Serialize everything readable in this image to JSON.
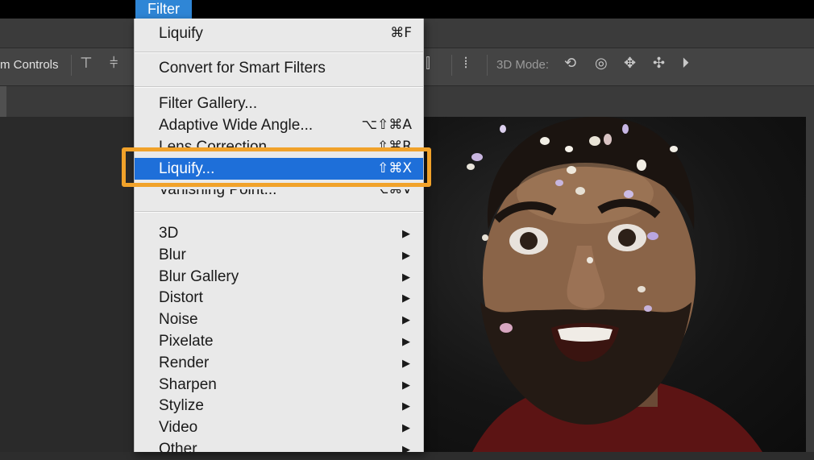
{
  "menubar": {
    "active_menu": "Filter"
  },
  "options_bar": {
    "transform_controls_label": "m Controls",
    "mode_3d_label": "3D Mode:"
  },
  "filter_menu": {
    "top_item": {
      "label": "Liquify",
      "shortcut": "⌘F"
    },
    "smart_filters": {
      "label": "Convert for Smart Filters"
    },
    "gallery_group": [
      {
        "label": "Filter Gallery...",
        "shortcut": ""
      },
      {
        "label": "Adaptive Wide Angle...",
        "shortcut": "⌥⇧⌘A"
      },
      {
        "label": "Lens Correction...",
        "shortcut": "⇧⌘R"
      },
      {
        "label": "Liquify...",
        "shortcut": "⇧⌘X"
      },
      {
        "label": "Vanishing Point...",
        "shortcut": "⌥⌘V"
      }
    ],
    "submenus": [
      "3D",
      "Blur",
      "Blur Gallery",
      "Distort",
      "Noise",
      "Pixelate",
      "Render",
      "Sharpen",
      "Stylize",
      "Video",
      "Other"
    ],
    "submenu_arrow": "▶",
    "highlighted_item": "Liquify...",
    "highlight_color": "#1e6fd9",
    "annotation_color": "#f1a22a"
  },
  "icons": [
    "align-top-icon",
    "align-vcenter-icon",
    "distribute-icon",
    "rotate-3d-icon",
    "roll-3d-icon",
    "drag-3d-icon",
    "slide-3d-icon",
    "scale-3d-icon"
  ]
}
